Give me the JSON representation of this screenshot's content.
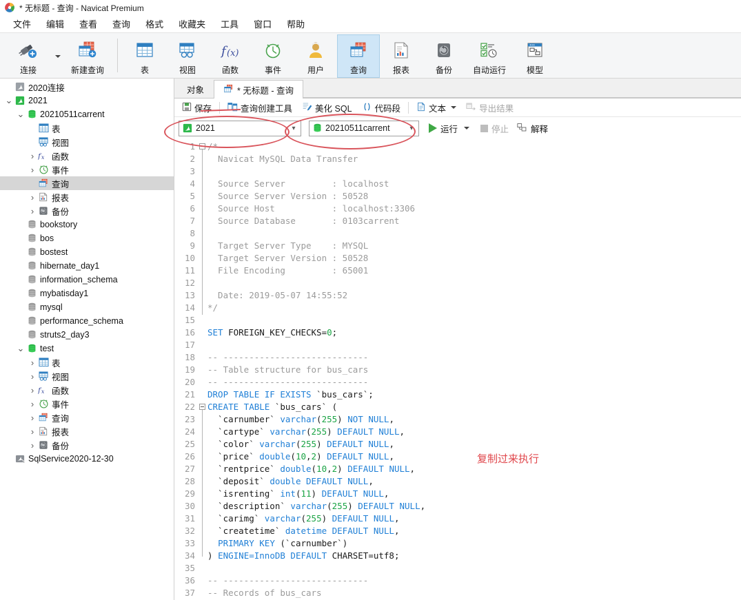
{
  "window": {
    "title": "* 无标题 - 查询 - Navicat Premium",
    "app_icon": "navicat-logo-icon"
  },
  "menubar": {
    "items": [
      {
        "label": "文件"
      },
      {
        "label": "编辑"
      },
      {
        "label": "查看"
      },
      {
        "label": "查询"
      },
      {
        "label": "格式"
      },
      {
        "label": "收藏夹"
      },
      {
        "label": "工具"
      },
      {
        "label": "窗口"
      },
      {
        "label": "帮助"
      }
    ]
  },
  "ribbon": {
    "group1": [
      {
        "label": "连接",
        "icon": "connection-plug-icon"
      },
      {
        "label": "新建查询",
        "icon": "new-query-icon"
      }
    ],
    "group2": [
      {
        "label": "表",
        "icon": "table-icon"
      },
      {
        "label": "视图",
        "icon": "view-icon"
      },
      {
        "label": "函数",
        "icon": "function-fx-icon"
      },
      {
        "label": "事件",
        "icon": "event-clock-icon"
      },
      {
        "label": "用户",
        "icon": "user-icon"
      },
      {
        "label": "查询",
        "icon": "query-icon",
        "active": true
      },
      {
        "label": "报表",
        "icon": "report-icon"
      },
      {
        "label": "备份",
        "icon": "backup-icon"
      },
      {
        "label": "自动运行",
        "icon": "automation-icon"
      },
      {
        "label": "模型",
        "icon": "model-icon"
      }
    ]
  },
  "sidebar": {
    "nodes": [
      {
        "label": "2020连接",
        "icon": "connection-icon",
        "indent": 0,
        "arrow": ""
      },
      {
        "label": "2021",
        "icon": "connection-icon-green",
        "indent": 0,
        "arrow": "down"
      },
      {
        "label": "20210511carrent",
        "icon": "database-icon-green",
        "indent": 1,
        "arrow": "down"
      },
      {
        "label": "表",
        "icon": "table-icon",
        "indent": 2,
        "arrow": ""
      },
      {
        "label": "视图",
        "icon": "view-icon",
        "indent": 2,
        "arrow": ""
      },
      {
        "label": "函数",
        "icon": "function-fx-icon",
        "indent": 2,
        "arrow": "right"
      },
      {
        "label": "事件",
        "icon": "event-clock-icon",
        "indent": 2,
        "arrow": "right"
      },
      {
        "label": "查询",
        "icon": "query-icon",
        "indent": 2,
        "arrow": "",
        "selected": true
      },
      {
        "label": "报表",
        "icon": "report-icon",
        "indent": 2,
        "arrow": "right"
      },
      {
        "label": "备份",
        "icon": "backup-icon",
        "indent": 2,
        "arrow": "right"
      },
      {
        "label": "bookstory",
        "icon": "database-icon-grey",
        "indent": 1,
        "arrow": ""
      },
      {
        "label": "bos",
        "icon": "database-icon-grey",
        "indent": 1,
        "arrow": ""
      },
      {
        "label": "bostest",
        "icon": "database-icon-grey",
        "indent": 1,
        "arrow": ""
      },
      {
        "label": "hibernate_day1",
        "icon": "database-icon-grey",
        "indent": 1,
        "arrow": ""
      },
      {
        "label": "information_schema",
        "icon": "database-icon-grey",
        "indent": 1,
        "arrow": ""
      },
      {
        "label": "mybatisday1",
        "icon": "database-icon-grey",
        "indent": 1,
        "arrow": ""
      },
      {
        "label": "mysql",
        "icon": "database-icon-grey",
        "indent": 1,
        "arrow": ""
      },
      {
        "label": "performance_schema",
        "icon": "database-icon-grey",
        "indent": 1,
        "arrow": ""
      },
      {
        "label": "struts2_day3",
        "icon": "database-icon-grey",
        "indent": 1,
        "arrow": ""
      },
      {
        "label": "test",
        "icon": "database-icon-green",
        "indent": 1,
        "arrow": "down"
      },
      {
        "label": "表",
        "icon": "table-icon",
        "indent": 2,
        "arrow": "right"
      },
      {
        "label": "视图",
        "icon": "view-icon",
        "indent": 2,
        "arrow": "right"
      },
      {
        "label": "函数",
        "icon": "function-fx-icon",
        "indent": 2,
        "arrow": "right"
      },
      {
        "label": "事件",
        "icon": "event-clock-icon",
        "indent": 2,
        "arrow": "right"
      },
      {
        "label": "查询",
        "icon": "query-icon",
        "indent": 2,
        "arrow": "right"
      },
      {
        "label": "报表",
        "icon": "report-icon",
        "indent": 2,
        "arrow": "right"
      },
      {
        "label": "备份",
        "icon": "backup-icon",
        "indent": 2,
        "arrow": "right"
      },
      {
        "label": "SqlService2020-12-30",
        "icon": "sqlserver-icon",
        "indent": 0,
        "arrow": ""
      }
    ]
  },
  "tabs": [
    {
      "label": "对象",
      "active": false,
      "icon": ""
    },
    {
      "label": "* 无标题 - 查询",
      "active": true,
      "icon": "query-icon"
    }
  ],
  "query_toolbar": {
    "buttons": [
      {
        "label": "保存",
        "icon": "save-icon",
        "enabled": true
      },
      {
        "label": "查询创建工具",
        "icon": "query-builder-icon",
        "enabled": true
      },
      {
        "label": "美化 SQL",
        "icon": "beautify-icon",
        "enabled": true
      },
      {
        "label": "代码段",
        "icon": "snippet-icon",
        "enabled": true
      },
      {
        "label": "文本",
        "icon": "text-icon",
        "enabled": true,
        "has_caret": true
      },
      {
        "label": "导出结果",
        "icon": "export-icon",
        "enabled": false
      }
    ]
  },
  "selector_bar": {
    "connection": {
      "value": "2021",
      "icon": "connection-icon-green"
    },
    "database": {
      "value": "20210511carrent",
      "icon": "database-icon-green"
    },
    "run_label": "运行",
    "stop_label": "停止",
    "explain_label": "解释"
  },
  "annotation": {
    "note_text": "复制过来执行",
    "note_color": "#e0474c",
    "circle_color": "#d9545b"
  },
  "editor": {
    "first_line": 1,
    "lines": [
      {
        "n": 1,
        "tokens": [
          {
            "t": "/*",
            "c": "cm"
          }
        ]
      },
      {
        "n": 2,
        "tokens": [
          {
            "t": "  Navicat MySQL Data Transfer",
            "c": "cm"
          }
        ]
      },
      {
        "n": 3,
        "tokens": [
          {
            "t": "",
            "c": "cm"
          }
        ]
      },
      {
        "n": 4,
        "tokens": [
          {
            "t": "  Source Server         : localhost",
            "c": "cm"
          }
        ]
      },
      {
        "n": 5,
        "tokens": [
          {
            "t": "  Source Server Version : 50528",
            "c": "cm"
          }
        ]
      },
      {
        "n": 6,
        "tokens": [
          {
            "t": "  Source Host           : localhost:3306",
            "c": "cm"
          }
        ]
      },
      {
        "n": 7,
        "tokens": [
          {
            "t": "  Source Database       : 0103carrent",
            "c": "cm"
          }
        ]
      },
      {
        "n": 8,
        "tokens": [
          {
            "t": "",
            "c": "cm"
          }
        ]
      },
      {
        "n": 9,
        "tokens": [
          {
            "t": "  Target Server Type    : MYSQL",
            "c": "cm"
          }
        ]
      },
      {
        "n": 10,
        "tokens": [
          {
            "t": "  Target Server Version : 50528",
            "c": "cm"
          }
        ]
      },
      {
        "n": 11,
        "tokens": [
          {
            "t": "  File Encoding         : 65001",
            "c": "cm"
          }
        ]
      },
      {
        "n": 12,
        "tokens": [
          {
            "t": "",
            "c": "cm"
          }
        ]
      },
      {
        "n": 13,
        "tokens": [
          {
            "t": "  Date: 2019-05-07 14:55:52",
            "c": "cm"
          }
        ]
      },
      {
        "n": 14,
        "tokens": [
          {
            "t": "*/",
            "c": "cm"
          }
        ]
      },
      {
        "n": 15,
        "tokens": [
          {
            "t": "",
            "c": "id"
          }
        ]
      },
      {
        "n": 16,
        "tokens": [
          {
            "t": "SET",
            "c": "k"
          },
          {
            "t": " FOREIGN_KEY_CHECKS=",
            "c": "id"
          },
          {
            "t": "0",
            "c": "n"
          },
          {
            "t": ";",
            "c": "id"
          }
        ]
      },
      {
        "n": 17,
        "tokens": [
          {
            "t": "",
            "c": "id"
          }
        ]
      },
      {
        "n": 18,
        "tokens": [
          {
            "t": "-- ----------------------------",
            "c": "cm"
          }
        ]
      },
      {
        "n": 19,
        "tokens": [
          {
            "t": "-- Table structure for bus_cars",
            "c": "cm"
          }
        ]
      },
      {
        "n": 20,
        "tokens": [
          {
            "t": "-- ----------------------------",
            "c": "cm"
          }
        ]
      },
      {
        "n": 21,
        "tokens": [
          {
            "t": "DROP TABLE IF EXISTS",
            "c": "k"
          },
          {
            "t": " `bus_cars`;",
            "c": "id"
          }
        ]
      },
      {
        "n": 22,
        "tokens": [
          {
            "t": "CREATE TABLE",
            "c": "k"
          },
          {
            "t": " `bus_cars` (",
            "c": "id"
          }
        ]
      },
      {
        "n": 23,
        "tokens": [
          {
            "t": "  `carnumber` ",
            "c": "id"
          },
          {
            "t": "varchar",
            "c": "k"
          },
          {
            "t": "(",
            "c": "id"
          },
          {
            "t": "255",
            "c": "n"
          },
          {
            "t": ") ",
            "c": "id"
          },
          {
            "t": "NOT NULL",
            "c": "k"
          },
          {
            "t": ",",
            "c": "id"
          }
        ]
      },
      {
        "n": 24,
        "tokens": [
          {
            "t": "  `cartype` ",
            "c": "id"
          },
          {
            "t": "varchar",
            "c": "k"
          },
          {
            "t": "(",
            "c": "id"
          },
          {
            "t": "255",
            "c": "n"
          },
          {
            "t": ") ",
            "c": "id"
          },
          {
            "t": "DEFAULT NULL",
            "c": "k"
          },
          {
            "t": ",",
            "c": "id"
          }
        ]
      },
      {
        "n": 25,
        "tokens": [
          {
            "t": "  `color` ",
            "c": "id"
          },
          {
            "t": "varchar",
            "c": "k"
          },
          {
            "t": "(",
            "c": "id"
          },
          {
            "t": "255",
            "c": "n"
          },
          {
            "t": ") ",
            "c": "id"
          },
          {
            "t": "DEFAULT NULL",
            "c": "k"
          },
          {
            "t": ",",
            "c": "id"
          }
        ]
      },
      {
        "n": 26,
        "tokens": [
          {
            "t": "  `price` ",
            "c": "id"
          },
          {
            "t": "double",
            "c": "k"
          },
          {
            "t": "(",
            "c": "id"
          },
          {
            "t": "10",
            "c": "n"
          },
          {
            "t": ",",
            "c": "id"
          },
          {
            "t": "2",
            "c": "n"
          },
          {
            "t": ") ",
            "c": "id"
          },
          {
            "t": "DEFAULT NULL",
            "c": "k"
          },
          {
            "t": ",",
            "c": "id"
          }
        ]
      },
      {
        "n": 27,
        "tokens": [
          {
            "t": "  `rentprice` ",
            "c": "id"
          },
          {
            "t": "double",
            "c": "k"
          },
          {
            "t": "(",
            "c": "id"
          },
          {
            "t": "10",
            "c": "n"
          },
          {
            "t": ",",
            "c": "id"
          },
          {
            "t": "2",
            "c": "n"
          },
          {
            "t": ") ",
            "c": "id"
          },
          {
            "t": "DEFAULT NULL",
            "c": "k"
          },
          {
            "t": ",",
            "c": "id"
          }
        ]
      },
      {
        "n": 28,
        "tokens": [
          {
            "t": "  `deposit` ",
            "c": "id"
          },
          {
            "t": "double DEFAULT NULL",
            "c": "k"
          },
          {
            "t": ",",
            "c": "id"
          }
        ]
      },
      {
        "n": 29,
        "tokens": [
          {
            "t": "  `isrenting` ",
            "c": "id"
          },
          {
            "t": "int",
            "c": "k"
          },
          {
            "t": "(",
            "c": "id"
          },
          {
            "t": "11",
            "c": "n"
          },
          {
            "t": ") ",
            "c": "id"
          },
          {
            "t": "DEFAULT NULL",
            "c": "k"
          },
          {
            "t": ",",
            "c": "id"
          }
        ]
      },
      {
        "n": 30,
        "tokens": [
          {
            "t": "  `description` ",
            "c": "id"
          },
          {
            "t": "varchar",
            "c": "k"
          },
          {
            "t": "(",
            "c": "id"
          },
          {
            "t": "255",
            "c": "n"
          },
          {
            "t": ") ",
            "c": "id"
          },
          {
            "t": "DEFAULT NULL",
            "c": "k"
          },
          {
            "t": ",",
            "c": "id"
          }
        ]
      },
      {
        "n": 31,
        "tokens": [
          {
            "t": "  `carimg` ",
            "c": "id"
          },
          {
            "t": "varchar",
            "c": "k"
          },
          {
            "t": "(",
            "c": "id"
          },
          {
            "t": "255",
            "c": "n"
          },
          {
            "t": ") ",
            "c": "id"
          },
          {
            "t": "DEFAULT NULL",
            "c": "k"
          },
          {
            "t": ",",
            "c": "id"
          }
        ]
      },
      {
        "n": 32,
        "tokens": [
          {
            "t": "  `createtime` ",
            "c": "id"
          },
          {
            "t": "datetime DEFAULT NULL",
            "c": "k"
          },
          {
            "t": ",",
            "c": "id"
          }
        ]
      },
      {
        "n": 33,
        "tokens": [
          {
            "t": "  ",
            "c": "id"
          },
          {
            "t": "PRIMARY KEY",
            "c": "k"
          },
          {
            "t": " (`carnumber`)",
            "c": "id"
          }
        ]
      },
      {
        "n": 34,
        "tokens": [
          {
            "t": ") ",
            "c": "id"
          },
          {
            "t": "ENGINE=InnoDB DEFAULT",
            "c": "k"
          },
          {
            "t": " CHARSET=utf8;",
            "c": "id"
          }
        ]
      },
      {
        "n": 35,
        "tokens": [
          {
            "t": "",
            "c": "id"
          }
        ]
      },
      {
        "n": 36,
        "tokens": [
          {
            "t": "-- ----------------------------",
            "c": "cm"
          }
        ]
      },
      {
        "n": 37,
        "tokens": [
          {
            "t": "-- Records of bus_cars",
            "c": "cm"
          }
        ]
      }
    ]
  }
}
